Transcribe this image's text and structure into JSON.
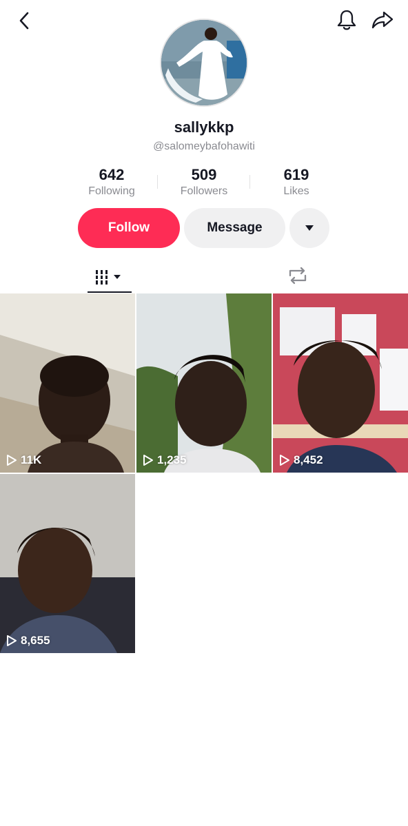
{
  "profile": {
    "display_name": "sallykkp",
    "handle": "@salomeybafohawiti"
  },
  "stats": [
    {
      "value": "642",
      "label": "Following"
    },
    {
      "value": "509",
      "label": "Followers"
    },
    {
      "value": "619",
      "label": "Likes"
    }
  ],
  "actions": {
    "follow_label": "Follow",
    "message_label": "Message"
  },
  "icons": {
    "back": "chevron-left-icon",
    "bell": "bell-icon",
    "share": "share-icon",
    "more": "caret-down-icon",
    "videos_tab": "grid-icon",
    "reposts_tab": "repost-icon",
    "play": "play-icon"
  },
  "colors": {
    "accent": "#fe2c55",
    "secondary_button": "#f0f0f1",
    "muted_text": "#8a8b91"
  },
  "videos": [
    {
      "views": "11K"
    },
    {
      "views": "1,235"
    },
    {
      "views": "8,452"
    },
    {
      "views": "8,655"
    }
  ]
}
